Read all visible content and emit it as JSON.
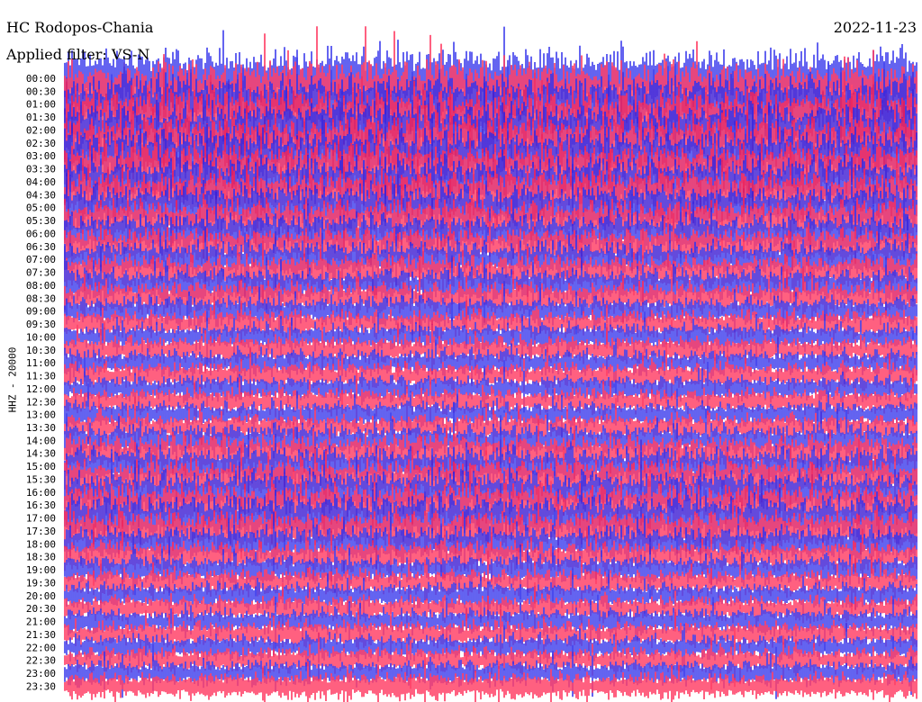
{
  "header": {
    "station": "HC Rodopos-Chania",
    "filter_note": "Applied filter: VS-N",
    "date": "2022-11-23"
  },
  "channel_label": "HHZ - 20000",
  "chart_data": {
    "type": "line",
    "subtype": "helicorder",
    "title": "HC Rodopos-Chania",
    "date": "2022-11-23",
    "ylabel": "HHZ - 20000",
    "xlabel": "",
    "grid": false,
    "legend": "none",
    "row_colors": [
      "#1010e8",
      "#ff0a3c"
    ],
    "rows": [
      {
        "time": "00:00",
        "level": 0.95
      },
      {
        "time": "00:30",
        "level": 0.95
      },
      {
        "time": "01:00",
        "level": 0.95
      },
      {
        "time": "01:30",
        "level": 0.92
      },
      {
        "time": "02:00",
        "level": 0.9
      },
      {
        "time": "02:30",
        "level": 0.9
      },
      {
        "time": "03:00",
        "level": 0.88
      },
      {
        "time": "03:30",
        "level": 0.85
      },
      {
        "time": "04:00",
        "level": 0.82
      },
      {
        "time": "04:30",
        "level": 0.8
      },
      {
        "time": "05:00",
        "level": 0.72
      },
      {
        "time": "05:30",
        "level": 0.65
      },
      {
        "time": "06:00",
        "level": 0.58
      },
      {
        "time": "06:30",
        "level": 0.55
      },
      {
        "time": "07:00",
        "level": 0.52
      },
      {
        "time": "07:30",
        "level": 0.5
      },
      {
        "time": "08:00",
        "level": 0.48
      },
      {
        "time": "08:30",
        "level": 0.45
      },
      {
        "time": "09:00",
        "level": 0.4
      },
      {
        "time": "09:30",
        "level": 0.38
      },
      {
        "time": "10:00",
        "level": 0.36
      },
      {
        "time": "10:30",
        "level": 0.36
      },
      {
        "time": "11:00",
        "level": 0.35
      },
      {
        "time": "11:30",
        "level": 0.35
      },
      {
        "time": "12:00",
        "level": 0.34
      },
      {
        "time": "12:30",
        "level": 0.33
      },
      {
        "time": "13:00",
        "level": 0.33
      },
      {
        "time": "13:30",
        "level": 0.34
      },
      {
        "time": "14:00",
        "level": 0.45
      },
      {
        "time": "14:30",
        "level": 0.55
      },
      {
        "time": "15:00",
        "level": 0.6
      },
      {
        "time": "15:30",
        "level": 0.62
      },
      {
        "time": "16:00",
        "level": 0.65
      },
      {
        "time": "16:30",
        "level": 0.68
      },
      {
        "time": "17:00",
        "level": 0.72
      },
      {
        "time": "17:30",
        "level": 0.6
      },
      {
        "time": "18:00",
        "level": 0.5
      },
      {
        "time": "18:30",
        "level": 0.42
      },
      {
        "time": "19:00",
        "level": 0.38
      },
      {
        "time": "19:30",
        "level": 0.35
      },
      {
        "time": "20:00",
        "level": 0.34
      },
      {
        "time": "20:30",
        "level": 0.34
      },
      {
        "time": "21:00",
        "level": 0.34
      },
      {
        "time": "21:30",
        "level": 0.34
      },
      {
        "time": "22:00",
        "level": 0.33
      },
      {
        "time": "22:30",
        "level": 0.33
      },
      {
        "time": "23:00",
        "level": 0.33
      },
      {
        "time": "23:30",
        "level": 0.34
      }
    ]
  }
}
